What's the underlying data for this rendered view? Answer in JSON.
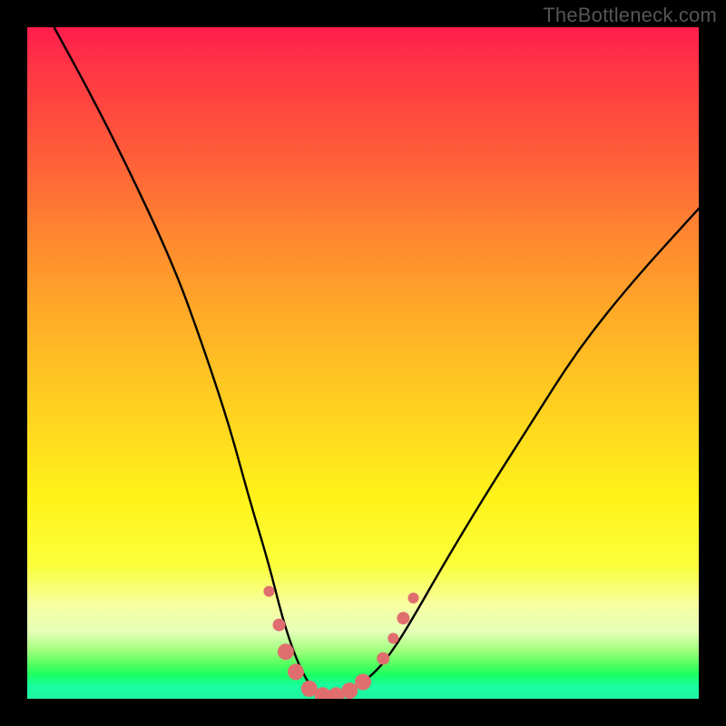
{
  "watermark": "TheBottleneck.com",
  "chart_data": {
    "type": "line",
    "title": "",
    "xlabel": "",
    "ylabel": "",
    "xlim": [
      0,
      100
    ],
    "ylim": [
      0,
      100
    ],
    "background_gradient": {
      "top": "#ff1d4d",
      "mid_upper": "#ff8a2f",
      "mid": "#fff21a",
      "lower_band": "#f7ffa0",
      "optimal_band": "#19ff9e"
    },
    "series": [
      {
        "name": "bottleneck-curve",
        "x": [
          4,
          10,
          16,
          22,
          26,
          30,
          33,
          36,
          38,
          40,
          42,
          44,
          46,
          48,
          52,
          55,
          58,
          62,
          68,
          75,
          82,
          90,
          100
        ],
        "y": [
          100,
          89,
          77,
          64,
          53,
          41,
          30,
          20,
          12,
          6,
          2,
          0,
          0,
          1,
          4,
          8,
          13,
          20,
          30,
          41,
          52,
          62,
          73
        ]
      }
    ],
    "markers": {
      "name": "highlighted-points",
      "color": "#e06e6e",
      "points": [
        {
          "x": 36.0,
          "y": 16,
          "size": "sm"
        },
        {
          "x": 37.5,
          "y": 11,
          "size": "md"
        },
        {
          "x": 38.5,
          "y": 7,
          "size": "lg"
        },
        {
          "x": 40.0,
          "y": 4,
          "size": "lg"
        },
        {
          "x": 42.0,
          "y": 1.5,
          "size": "lg"
        },
        {
          "x": 44.0,
          "y": 0.5,
          "size": "lg"
        },
        {
          "x": 46.0,
          "y": 0.5,
          "size": "lg"
        },
        {
          "x": 48.0,
          "y": 1.2,
          "size": "lg"
        },
        {
          "x": 50.0,
          "y": 2.5,
          "size": "lg"
        },
        {
          "x": 53.0,
          "y": 6,
          "size": "md"
        },
        {
          "x": 54.5,
          "y": 9,
          "size": "sm"
        },
        {
          "x": 56.0,
          "y": 12,
          "size": "md"
        },
        {
          "x": 57.5,
          "y": 15,
          "size": "sm"
        }
      ]
    }
  }
}
